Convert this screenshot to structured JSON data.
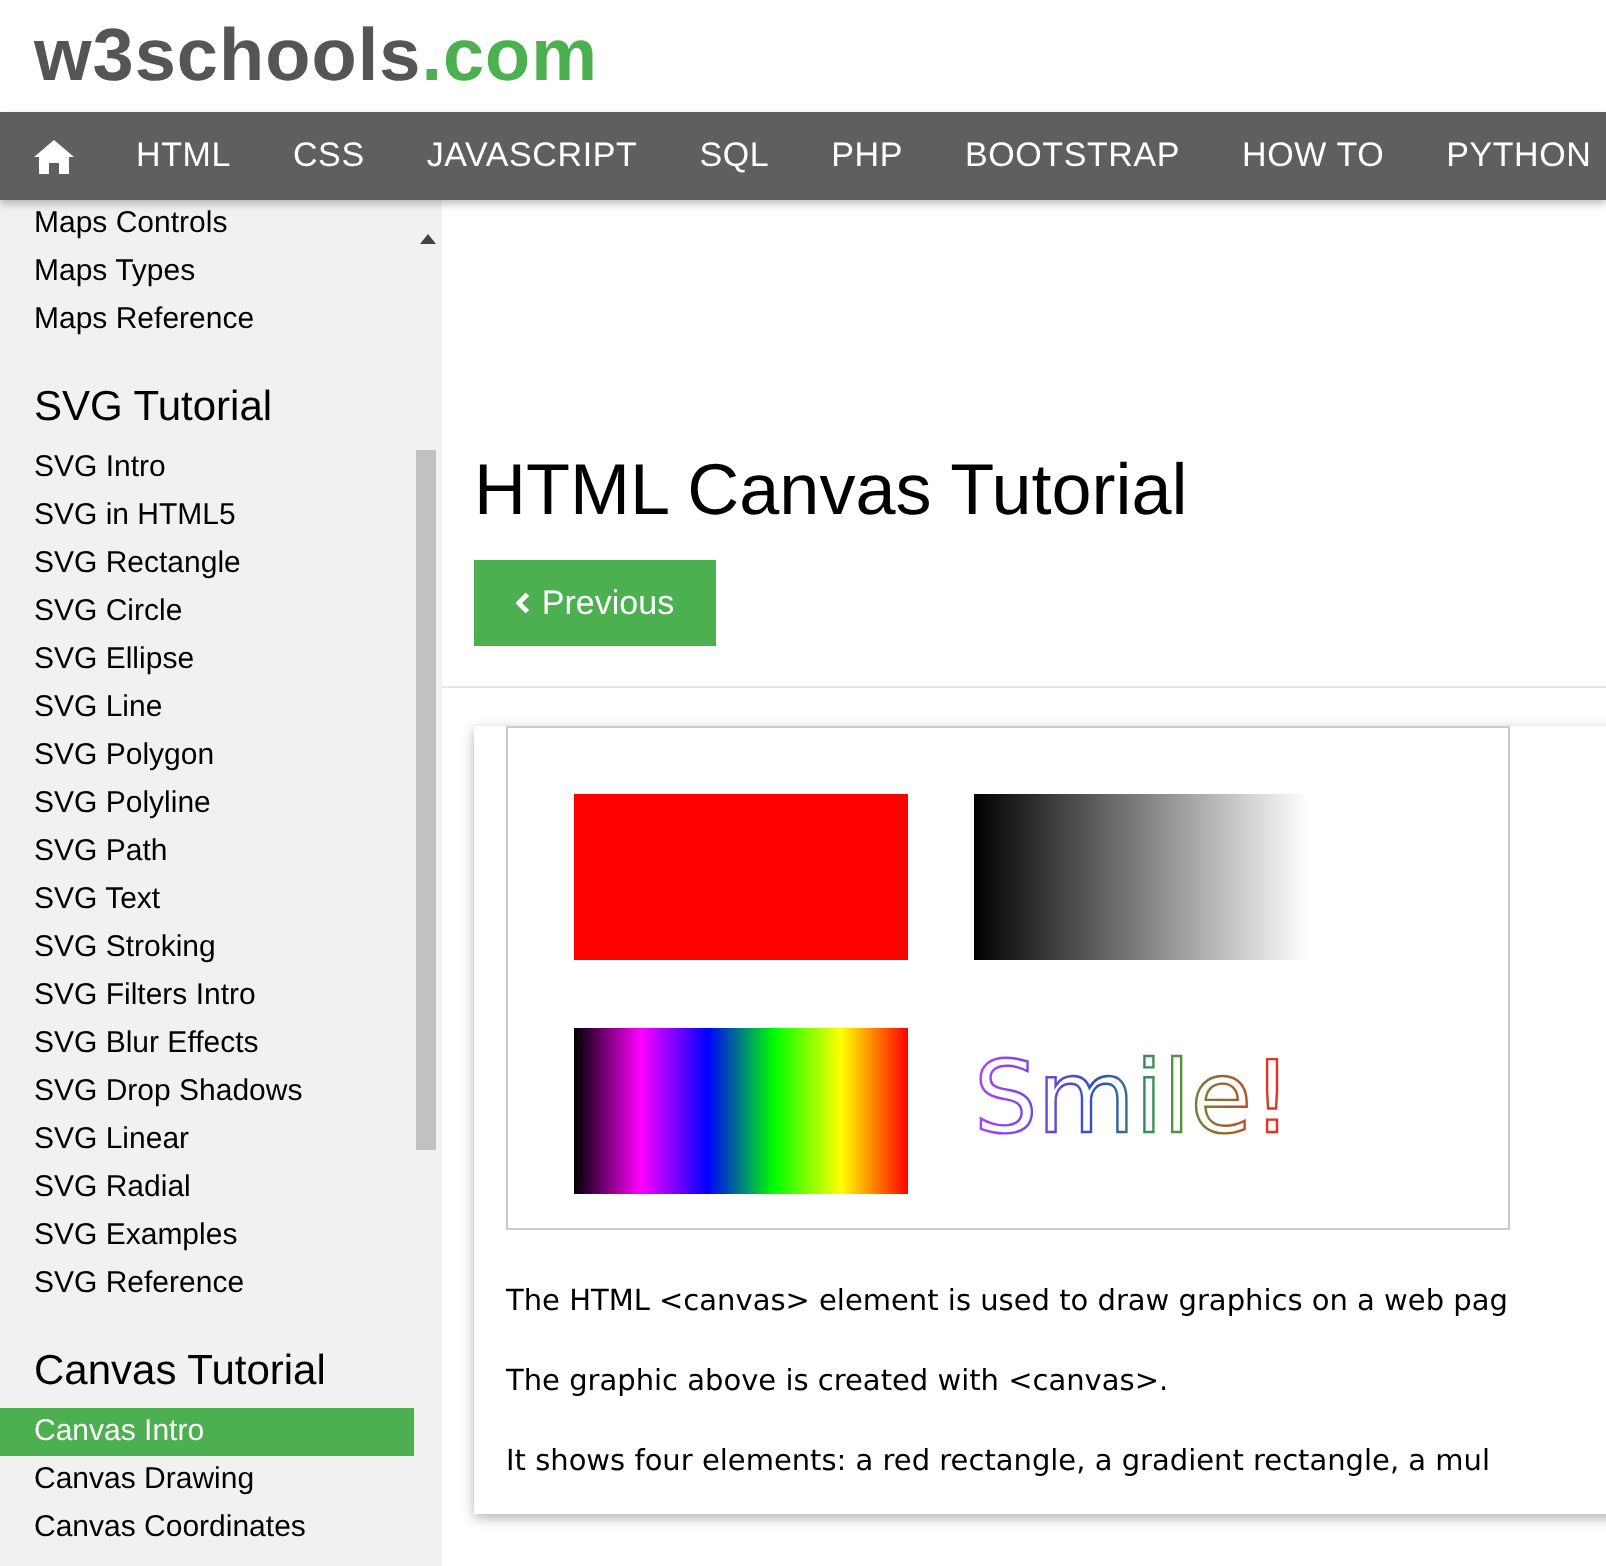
{
  "logo": {
    "name": "w3schools",
    "suffix": ".com"
  },
  "nav": {
    "items": [
      "HTML",
      "CSS",
      "JAVASCRIPT",
      "SQL",
      "PHP",
      "BOOTSTRAP",
      "HOW TO",
      "PYTHON"
    ]
  },
  "sidebar": {
    "sections": [
      {
        "items": [
          {
            "label": "Maps Controls",
            "selected": false
          },
          {
            "label": "Maps Types",
            "selected": false
          },
          {
            "label": "Maps Reference",
            "selected": false
          }
        ]
      },
      {
        "heading": "SVG Tutorial",
        "items": [
          {
            "label": "SVG Intro",
            "selected": false
          },
          {
            "label": "SVG in HTML5",
            "selected": false
          },
          {
            "label": "SVG Rectangle",
            "selected": false
          },
          {
            "label": "SVG Circle",
            "selected": false
          },
          {
            "label": "SVG Ellipse",
            "selected": false
          },
          {
            "label": "SVG Line",
            "selected": false
          },
          {
            "label": "SVG Polygon",
            "selected": false
          },
          {
            "label": "SVG Polyline",
            "selected": false
          },
          {
            "label": "SVG Path",
            "selected": false
          },
          {
            "label": "SVG Text",
            "selected": false
          },
          {
            "label": "SVG Stroking",
            "selected": false
          },
          {
            "label": "SVG Filters Intro",
            "selected": false
          },
          {
            "label": "SVG Blur Effects",
            "selected": false
          },
          {
            "label": "SVG Drop Shadows",
            "selected": false
          },
          {
            "label": "SVG Linear",
            "selected": false
          },
          {
            "label": "SVG Radial",
            "selected": false
          },
          {
            "label": "SVG Examples",
            "selected": false
          },
          {
            "label": "SVG Reference",
            "selected": false
          }
        ]
      },
      {
        "heading": "Canvas Tutorial",
        "items": [
          {
            "label": "Canvas Intro",
            "selected": true
          },
          {
            "label": "Canvas Drawing",
            "selected": false
          },
          {
            "label": "Canvas Coordinates",
            "selected": false
          }
        ]
      }
    ]
  },
  "main": {
    "title": "HTML Canvas Tutorial",
    "previous_button": "Previous",
    "example": {
      "smile_text": "Smile!",
      "paragraphs": [
        "The HTML <canvas> element is used to draw graphics on a web pag",
        "The graphic above is created with <canvas>.",
        "It shows four elements: a red rectangle, a gradient rectangle, a mul"
      ]
    }
  }
}
